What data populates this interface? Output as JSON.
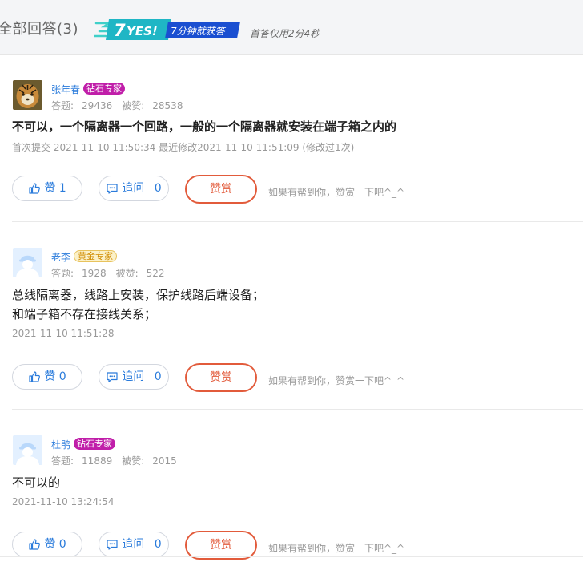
{
  "header": {
    "title": "全部回答(3)",
    "badge_number": "7",
    "badge_yes": "YES!",
    "badge_text": "7分钟就获答",
    "note": "首答仅用2分4秒"
  },
  "common": {
    "answers_label": "答题:",
    "liked_label": "被赞:",
    "ask_label": "追问",
    "reward_label": "赞赏",
    "hint": "如果有帮到你，赞赏一下吧^_^"
  },
  "answers": [
    {
      "user": "张年春",
      "level": "钻石专家",
      "answers_count": "29436",
      "liked_count": "28538",
      "content_lines": [
        "不可以，一个隔离器一个回路，一般的一个隔离器就安装在端子箱之内的"
      ],
      "meta": "首次提交 2021-11-10 11:50:34  最近修改2021-11-10 11:51:09 (修改过1次)",
      "like_label": "赞 1",
      "ask_count": "0"
    },
    {
      "user": "老李",
      "level": "黄金专家",
      "answers_count": "1928",
      "liked_count": "522",
      "content_lines": [
        "总线隔离器，线路上安装，保护线路后端设备；",
        "和端子箱不存在接线关系；"
      ],
      "meta": "2021-11-10 11:51:28",
      "like_label": "赞 0",
      "ask_count": "0"
    },
    {
      "user": "杜鹃",
      "level": "钻石专家",
      "answers_count": "11889",
      "liked_count": "2015",
      "content_lines": [
        "不可以的"
      ],
      "meta": "2021-11-10 13:24:54",
      "like_label": "赞 0",
      "ask_count": "0"
    }
  ],
  "colors": {
    "link_blue": "#2a7bdb",
    "reward_red": "#e25b3b",
    "diamond_tag": "#c01ea9",
    "gold_tag": "#d08b00"
  },
  "icons": [
    "thumb-up-icon",
    "comment-icon",
    "avatar-tiger",
    "avatar-default-worker"
  ]
}
